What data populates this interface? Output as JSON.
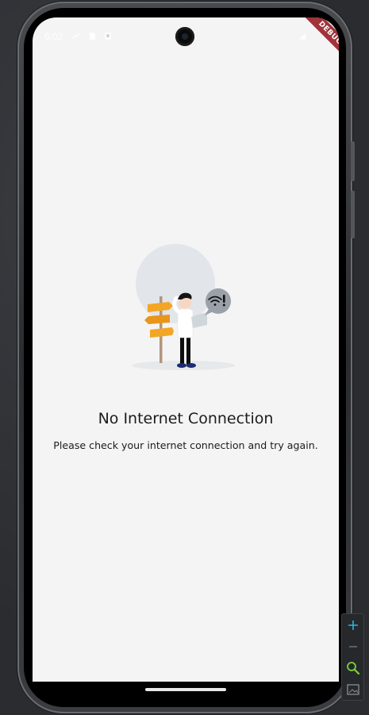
{
  "status_bar": {
    "time": "6:02",
    "debug_banner": "DEBUG"
  },
  "empty_state": {
    "title": "No Internet Connection",
    "message": "Please check your internet connection and try again."
  },
  "zoom_controls": {
    "zoom_in_icon": "plus-icon",
    "zoom_out_icon": "minus-icon",
    "magnifier_icon": "magnifier-icon",
    "screenshot_icon": "image-frame-icon"
  },
  "colors": {
    "screen_background": "#f4f4f4",
    "text": "#1c1c1c",
    "signpost_orange": "#f3a623",
    "debug_ribbon": "#a1333a",
    "zoom_accent": "#2bb5d8",
    "magnifier_green": "#7bd23b"
  }
}
